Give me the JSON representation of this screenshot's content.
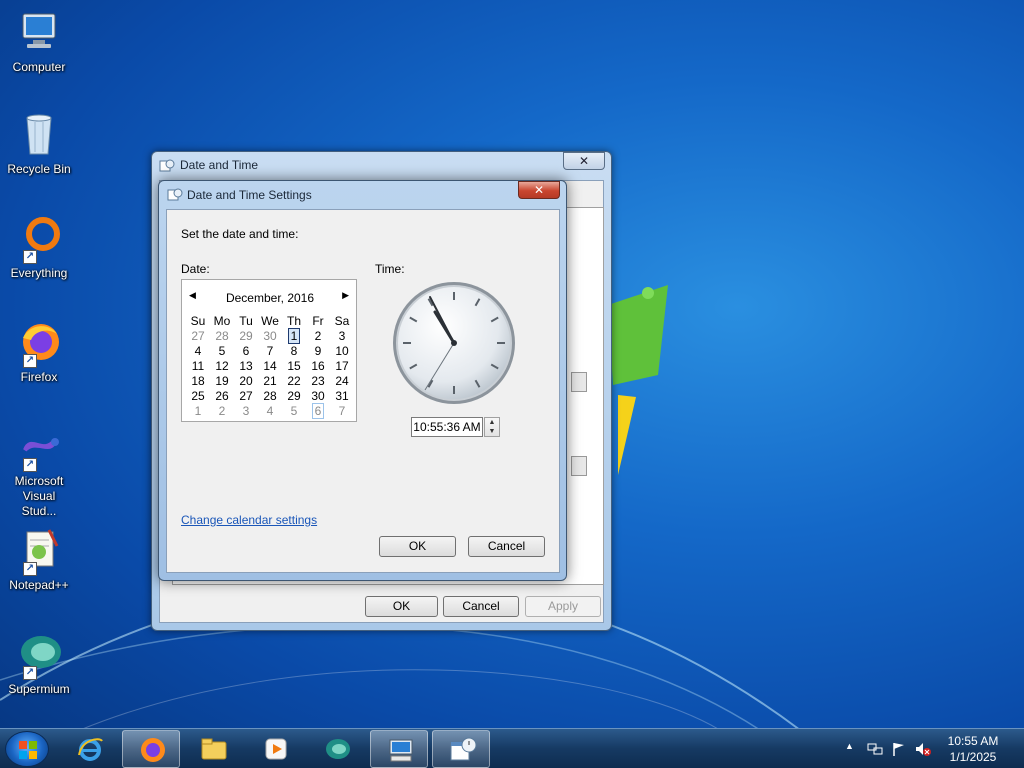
{
  "desktop": {
    "icons": [
      {
        "label": "Computer"
      },
      {
        "label": "Recycle Bin"
      },
      {
        "label": "Everything"
      },
      {
        "label": "Firefox"
      },
      {
        "label": "Microsoft Visual Stud..."
      },
      {
        "label": "Notepad++"
      },
      {
        "label": "Supermium"
      }
    ]
  },
  "outer_window": {
    "title": "Date and Time",
    "close_label": "✕",
    "buttons": {
      "ok": "OK",
      "cancel": "Cancel",
      "apply": "Apply"
    }
  },
  "dialog": {
    "title": "Date and Time Settings",
    "close_label": "✕",
    "prompt": "Set the date and time:",
    "date_label": "Date:",
    "time_label": "Time:",
    "calendar": {
      "month_label": "December, 2016",
      "prev_label": "◀",
      "next_label": "▶",
      "weekdays": [
        "Su",
        "Mo",
        "Tu",
        "We",
        "Th",
        "Fr",
        "Sa"
      ],
      "weeks": [
        [
          "27",
          "28",
          "29",
          "30",
          "1",
          "2",
          "3"
        ],
        [
          "4",
          "5",
          "6",
          "7",
          "8",
          "9",
          "10"
        ],
        [
          "11",
          "12",
          "13",
          "14",
          "15",
          "16",
          "17"
        ],
        [
          "18",
          "19",
          "20",
          "21",
          "22",
          "23",
          "24"
        ],
        [
          "25",
          "26",
          "27",
          "28",
          "29",
          "30",
          "31"
        ],
        [
          "1",
          "2",
          "3",
          "4",
          "5",
          "6",
          "7"
        ]
      ],
      "selected_day": "1",
      "today_marker_day": "6"
    },
    "time_value": "10:55:36 AM",
    "spin_up": "▲",
    "spin_down": "▼",
    "calendar_link": "Change calendar settings",
    "ok_label": "OK",
    "cancel_label": "Cancel"
  },
  "taskbar": {
    "tray_time": "10:55 AM",
    "tray_date": "1/1/2025",
    "tray_arrow": "▲",
    "items": [
      "internet-explorer",
      "firefox",
      "file-explorer",
      "media-player",
      "supermium",
      "remote-desktop",
      "date-time"
    ]
  }
}
